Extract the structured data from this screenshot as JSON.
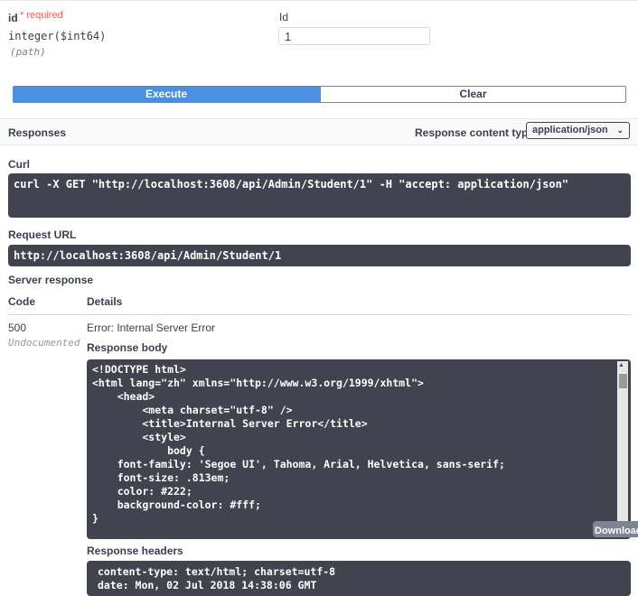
{
  "param": {
    "name": "id",
    "required_mark": "* required",
    "type": "integer($int64)",
    "location": "(path)",
    "description": "Id",
    "value": "1"
  },
  "buttons": {
    "execute": "Execute",
    "clear": "Clear"
  },
  "responses": {
    "title": "Responses",
    "content_type_label": "Response content type",
    "content_type_value": "application/json"
  },
  "curl": {
    "label": "Curl",
    "command": "curl -X GET \"http://localhost:3608/api/Admin/Student/1\" -H \"accept: application/json\""
  },
  "request_url": {
    "label": "Request URL",
    "value": "http://localhost:3608/api/Admin/Student/1"
  },
  "server_response": {
    "label": "Server response",
    "col_code": "Code",
    "col_details": "Details",
    "code": "500",
    "code_note": "Undocumented",
    "details": "Error: Internal Server Error",
    "body_label": "Response body",
    "body": "<!DOCTYPE html>\n<html lang=\"zh\" xmlns=\"http://www.w3.org/1999/xhtml\">\n    <head>\n        <meta charset=\"utf-8\" />\n        <title>Internal Server Error</title>\n        <style>\n            body {\n    font-family: 'Segoe UI', Tahoma, Arial, Helvetica, sans-serif;\n    font-size: .813em;\n    color: #222;\n    background-color: #fff;\n}",
    "download_label": "Download",
    "headers_label": "Response headers",
    "headers": "content-type: text/html; charset=utf-8\ndate: Mon, 02 Jul 2018 14:38:06 GMT"
  }
}
